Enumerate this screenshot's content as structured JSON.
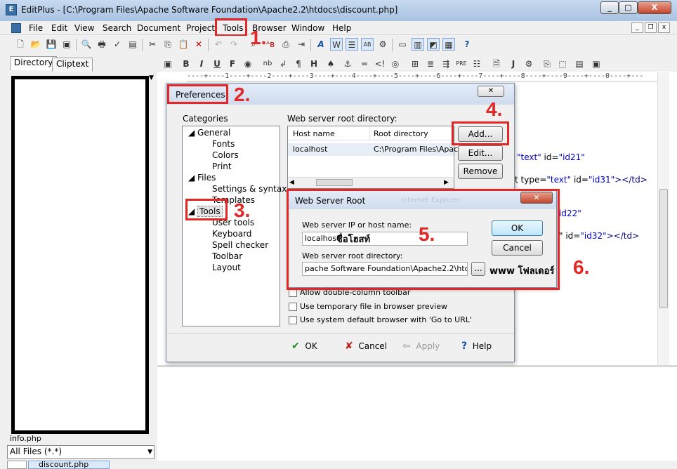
{
  "window": {
    "title": "EditPlus - [C:\\Program Files\\Apache Software Foundation\\Apache2.2\\htdocs\\discount.php]",
    "min": "_",
    "max": "□",
    "close": "X"
  },
  "menu": [
    "File",
    "Edit",
    "View",
    "Search",
    "Document",
    "Project",
    "Tools",
    "Browser",
    "Window",
    "Help"
  ],
  "left": {
    "tab_directory": "Directory",
    "tab_cliptext": "Cliptext",
    "dir_file": "info.php",
    "filter": "All Files (*.*)",
    "doc_tab": "discount.php"
  },
  "ruler": "----+----1----+----2----+----3----+----4----+----5----+----6----+----7----+----8----+----9----+----0----+---",
  "code": {
    "l1_str": "\"text\"",
    "l1_attr": " id=",
    "l1_str2": "\"id21\"",
    "l2_pre": "t type=",
    "l2_str": "\"text\"",
    "l2_attr": " id=",
    "l2_str2": "\"id31\"",
    "l2_tag": "></td>",
    "l3_str": "id22\"",
    "l4_pre": "\" id=",
    "l4_str": "\"id32\"",
    "l4_tag": "></td>"
  },
  "prefs": {
    "title": "Preferences",
    "categories_label": "Categories",
    "tree": {
      "general": "General",
      "fonts": "Fonts",
      "colors": "Colors",
      "print": "Print",
      "files": "Files",
      "settings_syntax": "Settings & syntax",
      "templates": "Templates",
      "tools": "Tools",
      "user_tools": "User tools",
      "keyboard": "Keyboard",
      "spell_checker": "Spell checker",
      "toolbar": "Toolbar",
      "layout": "Layout"
    },
    "root_dir_label": "Web server root directory:",
    "col_host": "Host name",
    "col_root": "Root directory",
    "row_host": "localhost",
    "row_root": "C:\\Program Files\\Apach",
    "add": "Add...",
    "edit": "Edit...",
    "remove": "Remove",
    "opt_double": "Allow double-column toolbar",
    "opt_temp": "Use temporary file in browser preview",
    "opt_default": "Use system default browser with 'Go to URL'",
    "ok": "OK",
    "cancel": "Cancel",
    "apply": "Apply",
    "help": "Help"
  },
  "wsr": {
    "title": "Web Server Root",
    "ghost_text": "Internet Explorer",
    "host_label": "Web server IP or host name:",
    "host_value": "localhost",
    "dir_label": "Web server root directory:",
    "dir_value": "pache Software Foundation\\Apache2.2\\htdocs",
    "browse": "...",
    "ok": "OK",
    "cancel": "Cancel"
  },
  "annotations": {
    "n1": "1.",
    "n2": "2.",
    "n3": "3.",
    "n4": "4.",
    "n5": "5.",
    "n6": "6.",
    "thai_host": "ชื่อโฮสท์",
    "thai_www": "www โฟลเดอร์"
  },
  "colors": {
    "annotation": "#e32626",
    "titlebar": "#b8cee9",
    "code_string": "#0000c8"
  }
}
